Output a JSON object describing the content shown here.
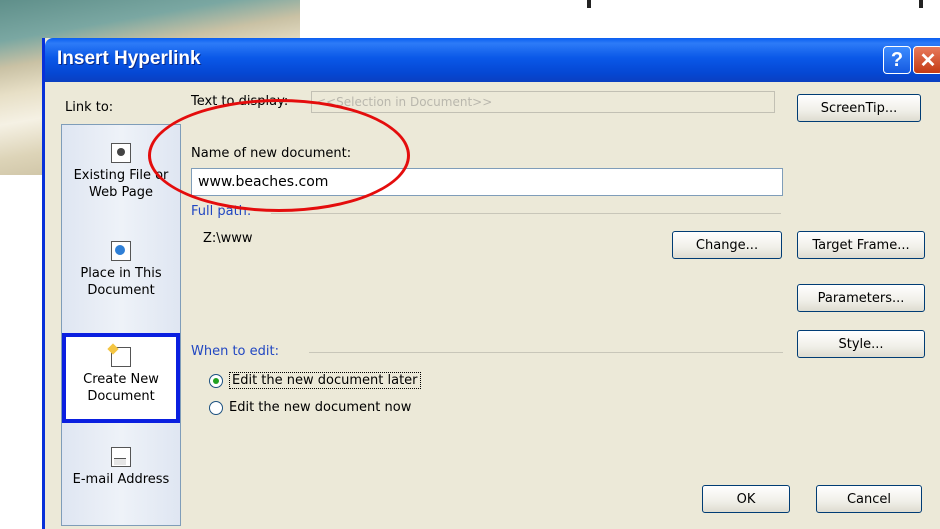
{
  "window": {
    "title": "Insert Hyperlink",
    "help_glyph": "?",
    "close_glyph": "✕"
  },
  "link_to": {
    "label": "Link to:",
    "items": [
      {
        "label_line1": "Existing File or",
        "label_line2": "Web Page",
        "icon": "file-icon"
      },
      {
        "label_line1": "Place in This",
        "label_line2": "Document",
        "icon": "place-in-document-icon"
      },
      {
        "label_line1": "Create New",
        "label_line2": "Document",
        "icon": "new-document-icon",
        "selected": true
      },
      {
        "label_line1": "E-mail Address",
        "label_line2": "",
        "icon": "email-icon"
      }
    ]
  },
  "text_to_display": {
    "label": "Text to display:",
    "value": "<<Selection in Document>>"
  },
  "new_document": {
    "label": "Name of new document:",
    "value": "www.beaches.com"
  },
  "full_path": {
    "label": "Full path:",
    "value": "Z:\\www"
  },
  "when_to_edit": {
    "label": "When to edit:",
    "options": [
      {
        "label": "Edit the new document later",
        "checked": true
      },
      {
        "label": "Edit the new document now",
        "checked": false
      }
    ]
  },
  "buttons": {
    "screentip": "ScreenTip...",
    "change": "Change...",
    "target_frame": "Target Frame...",
    "parameters": "Parameters...",
    "style": "Style...",
    "ok": "OK",
    "cancel": "Cancel"
  },
  "colors": {
    "titlebar": "#0a58e8",
    "annotation_ellipse": "#e40d0d",
    "selection_box": "#0a1fe0"
  }
}
